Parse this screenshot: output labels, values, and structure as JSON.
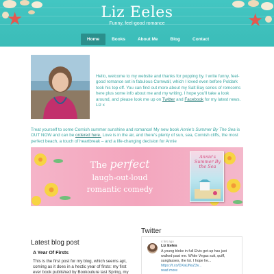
{
  "site": {
    "title": "Liz Eeles",
    "tagline": "Funny, feel-good romance"
  },
  "nav": {
    "items": [
      {
        "label": "Home",
        "active": true
      },
      {
        "label": "Books",
        "active": false
      },
      {
        "label": "About Me",
        "active": false
      },
      {
        "label": "Blog",
        "active": false
      },
      {
        "label": "Contact",
        "active": false
      }
    ]
  },
  "intro": {
    "text_before_twitter": "Hello, welcome to my website and thanks for popping by. I write funny, feel-good romance set in fabulous Cornwall, which I loved even before Poldark took his top off. You can find out more about my Salt Bay series of romcoms here plus some info about me and my writing. I hope you'll take a look around, and please look me up on ",
    "twitter_link": "Twitter",
    "and_text": " and ",
    "facebook_link": "Facebook",
    "text_after": " for my latest news.",
    "signoff": "Liz x"
  },
  "promo": {
    "text_1": "Treat yourself to some Cornish summer sunshine and romance! My new book ",
    "book_title": "Annie's Summer By The Sea",
    "text_2": " is OUT NOW and can be ",
    "order_link": "ordered here.",
    "text_3": " Love is in the air, and there's plenty of sun, sea, Cornish cliffs, the most perfect beach, a touch of heartbreak – and a life-changing decision for Annie"
  },
  "banner": {
    "line1_prefix": "The ",
    "line1_em": "perfect",
    "line2": "laugh-out-loud",
    "line3": "romantic comedy",
    "cover_title": "Annie's Summer By the Sea"
  },
  "blog": {
    "heading": "Latest blog post",
    "post_title": "A Year Of Firsts",
    "excerpt": "This is the first post for my blog, which seems apt, coming as it does in a hectic year of firsts: my first ever book published by Bookouture last Spring, my first"
  },
  "twitter": {
    "heading": "Twitter",
    "time": "4 hrs ago",
    "author": "Liz Eeles",
    "text": "A young bloke in full Elvis get-up has just walked past me. White Vegas suit, quiff, sunglasses, the lot. I hope he... ",
    "link": "https://t.co/DXaUNsZ3v...",
    "more": "read more"
  },
  "colors": {
    "header_teal": "#43c6c2",
    "nav_active": "#2b8f8c",
    "text_teal": "#3aa6a2",
    "banner_pink": "#f3a5bd",
    "starfish": "#e4584f"
  }
}
